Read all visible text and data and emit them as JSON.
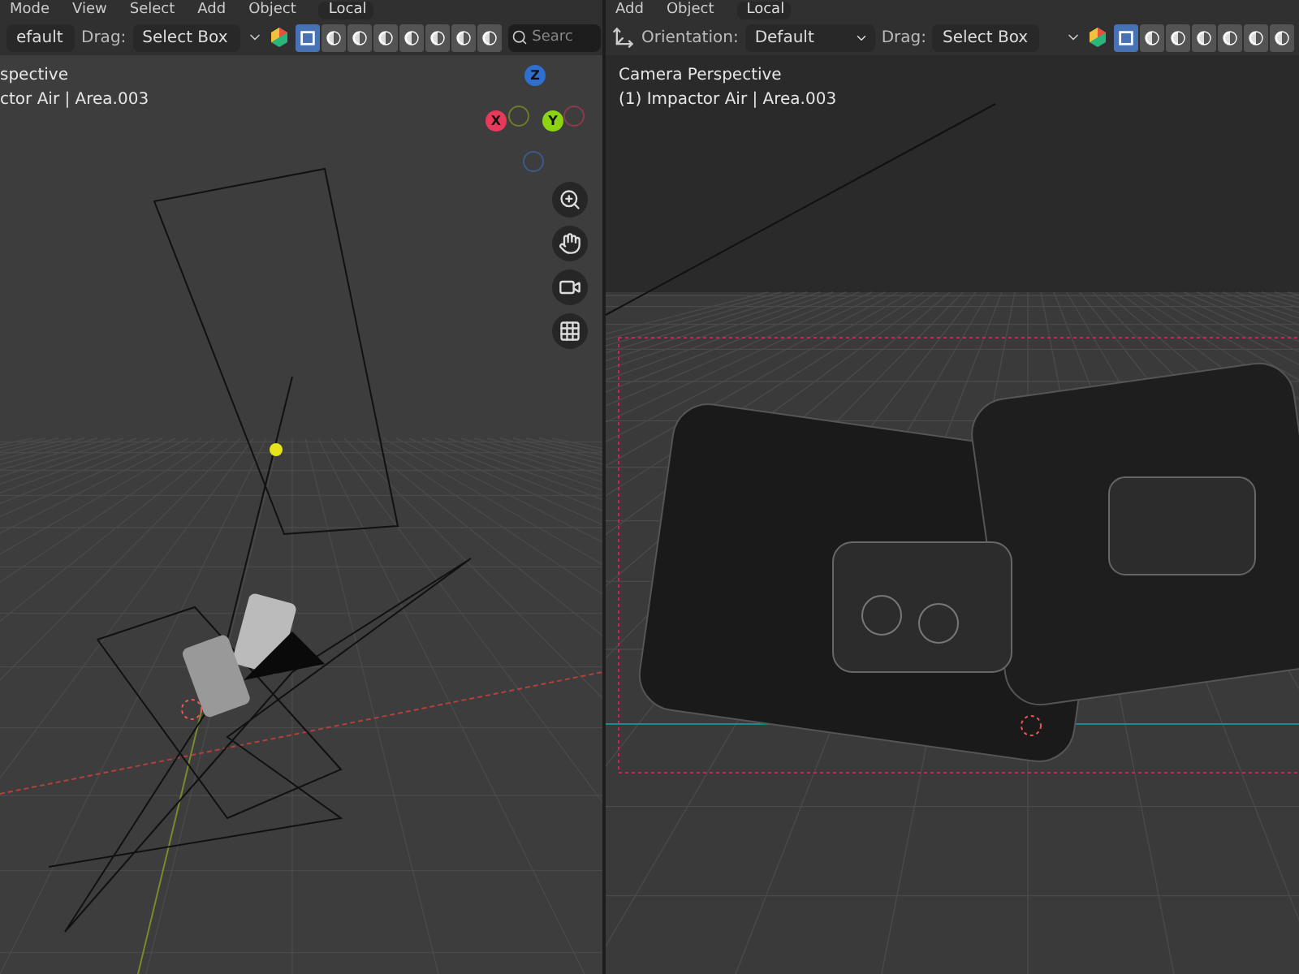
{
  "left_view": {
    "menu": [
      "Mode",
      "View",
      "Select",
      "Add",
      "Object"
    ],
    "transform": "Local",
    "orientation": "efault",
    "drag_label": "Drag:",
    "drag": "Select Box",
    "search": {
      "placeholder": "Searc"
    },
    "toggles": [
      {
        "selected": true
      },
      {
        "selected": false
      },
      {
        "selected": false
      },
      {
        "selected": false
      },
      {
        "selected": false
      },
      {
        "selected": false
      },
      {
        "selected": false
      },
      {
        "selected": false
      }
    ],
    "overlay": [
      "spective",
      "ctor Air | Area.003"
    ],
    "gizmo": {
      "x": "X",
      "y": "Y",
      "z": "Z"
    }
  },
  "right_view": {
    "menu": [
      "Add",
      "Object"
    ],
    "transform": "Local",
    "orientation_label": "Orientation:",
    "orientation": "Default",
    "drag_label": "Drag:",
    "drag": "Select Box",
    "toggles": [
      {
        "selected": true
      },
      {
        "selected": false
      },
      {
        "selected": false
      },
      {
        "selected": false
      },
      {
        "selected": false
      },
      {
        "selected": false
      },
      {
        "selected": false
      }
    ],
    "overlay": [
      "Camera Perspective",
      "(1) Impactor Air | Area.003"
    ]
  }
}
